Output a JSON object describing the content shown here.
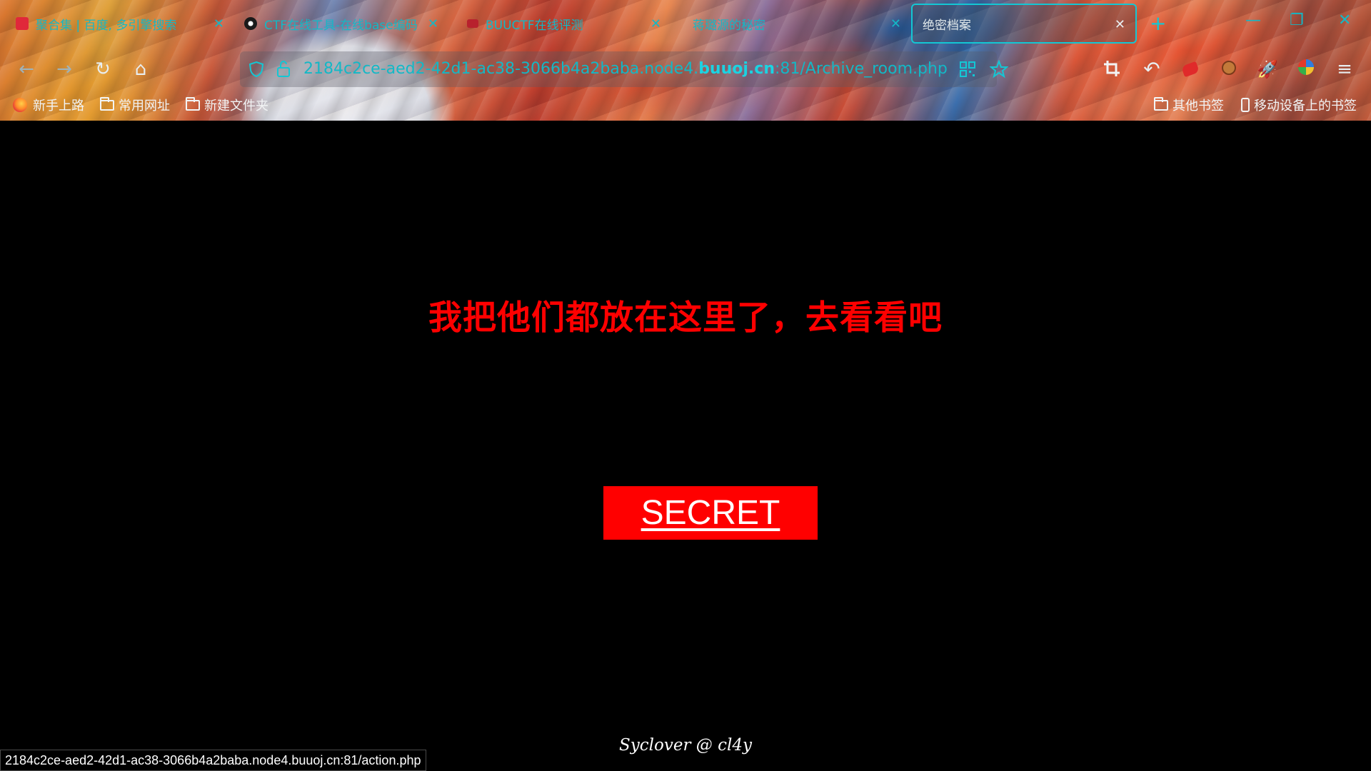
{
  "tabs": [
    {
      "title": "聚合集 | 百度, 多引擎搜索",
      "favicon_color": "#e0283a"
    },
    {
      "title": "CTF在线工具-在线base编码",
      "favicon_color": "#1a1a1a"
    },
    {
      "title": "BUUCTF在线评测",
      "favicon_color": "#b8212d"
    },
    {
      "title": "蒋璐源的秘密",
      "favicon_color": ""
    },
    {
      "title": "绝密档案",
      "favicon_color": "",
      "active": true
    }
  ],
  "address_bar": {
    "url_prefix": "2184c2ce-aed2-42d1-ac38-3066b4a2baba.node4.",
    "url_domain": "buuoj.cn",
    "url_suffix": ":81/Archive_room.php"
  },
  "bookmarks": {
    "left": [
      "新手上路",
      "常用网址",
      "新建文件夹"
    ],
    "right": [
      "其他书签",
      "移动设备上的书签"
    ]
  },
  "page": {
    "headline": "我把他们都放在这里了，去看看吧",
    "button_label": "SECRET",
    "footer": "Syclover @ cl4y"
  },
  "status_bar": "2184c2ce-aed2-42d1-ac38-3066b4a2baba.node4.buuoj.cn:81/action.php",
  "colors": {
    "accent_teal": "#13b8c6",
    "headline_red": "#ff0000",
    "button_red": "#ff0000"
  },
  "icons": {
    "nav": [
      "back-arrow-icon",
      "forward-arrow-icon",
      "reload-icon",
      "home-icon"
    ],
    "address": [
      "shield-icon",
      "lock-icon",
      "qr-code-icon",
      "star-icon"
    ],
    "toolbar": [
      "crop-icon",
      "undo-icon",
      "extension-red-icon",
      "extension-monkey-icon",
      "rocket-icon",
      "extension-globe-icon",
      "menu-icon"
    ]
  }
}
